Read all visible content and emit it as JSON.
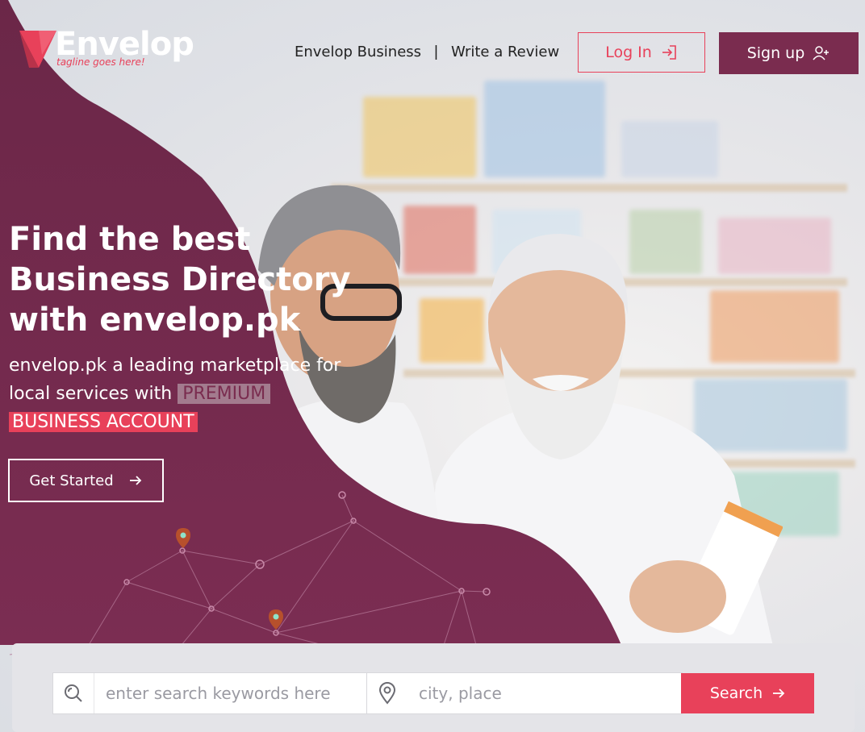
{
  "brand": {
    "logo_text": "Envelop",
    "tagline": "tagline goes here!"
  },
  "nav": {
    "business_link": "Envelop Business",
    "separator": "|",
    "review_link": "Write a Review",
    "login_label": "Log In",
    "signup_label": "Sign up"
  },
  "hero": {
    "headline_line1": "Find the best",
    "headline_line2": "Business Directory",
    "headline_line3": "with envelop.pk",
    "subtitle_prefix": "envelop.pk a leading marketplace for local services with",
    "highlight_premium": "PREMIUM",
    "highlight_business": "BUSINESS ACCOUNT",
    "cta_label": "Get Started"
  },
  "search": {
    "keyword_placeholder": "enter search keywords here",
    "location_placeholder": "city, place",
    "button_label": "Search"
  },
  "colors": {
    "brand_purple": "#7a2c4f",
    "accent_red": "#e8415a"
  },
  "icons": [
    "login-icon",
    "add-user-icon",
    "arrow-right-icon",
    "search-icon",
    "map-pin-icon"
  ]
}
